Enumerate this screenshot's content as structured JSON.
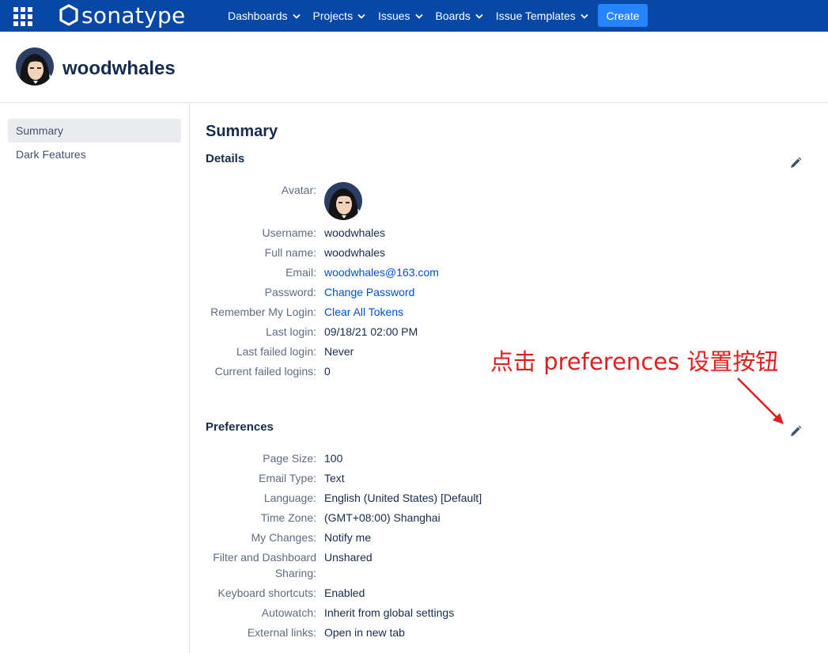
{
  "brand": {
    "name": "sonatype"
  },
  "topnav": {
    "items": [
      {
        "label": "Dashboards"
      },
      {
        "label": "Projects"
      },
      {
        "label": "Issues"
      },
      {
        "label": "Boards"
      },
      {
        "label": "Issue Templates"
      }
    ],
    "create_label": "Create"
  },
  "profile": {
    "name": "woodwhales"
  },
  "sidebar": {
    "items": [
      {
        "label": "Summary",
        "active": true
      },
      {
        "label": "Dark Features",
        "active": false
      }
    ]
  },
  "summary": {
    "title": "Summary",
    "details": {
      "heading": "Details",
      "avatar_label": "Avatar:",
      "rows": [
        {
          "label": "Username:",
          "value": "woodwhales"
        },
        {
          "label": "Full name:",
          "value": "woodwhales"
        },
        {
          "label": "Email:",
          "value": "woodwhales@163.com"
        },
        {
          "label": "Password:",
          "value": "Change Password"
        },
        {
          "label": "Remember My Login:",
          "value": "Clear All Tokens"
        },
        {
          "label": "Last login:",
          "value": "09/18/21 02:00 PM"
        },
        {
          "label": "Last failed login:",
          "value": "Never"
        },
        {
          "label": "Current failed logins:",
          "value": "0"
        }
      ]
    },
    "preferences": {
      "heading": "Preferences",
      "rows": [
        {
          "label": "Page Size:",
          "value": "100"
        },
        {
          "label": "Email Type:",
          "value": "Text"
        },
        {
          "label": "Language:",
          "value": "English (United States) [Default]"
        },
        {
          "label": "Time Zone:",
          "value": "(GMT+08:00) Shanghai"
        },
        {
          "label": "My Changes:",
          "value": "Notify me"
        },
        {
          "label": "Filter and Dashboard",
          "label2": "Sharing:",
          "value": "Unshared"
        },
        {
          "label": "Keyboard shortcuts:",
          "value": "Enabled"
        },
        {
          "label": "Autowatch:",
          "value": "Inherit from global settings"
        },
        {
          "label": "External links:",
          "value": "Open in new tab"
        }
      ]
    }
  },
  "annotation": {
    "text": "点击 preferences 设置按钮"
  },
  "icons": {
    "app_switcher": "grid-icon",
    "edit": "pencil-icon",
    "chevron": "chevron-down-icon",
    "arrow": "arrow-icon"
  },
  "colors": {
    "topbar": "#0747a6",
    "create_button": "#2684ff",
    "link": "#0052cc",
    "annotation": "#e02020"
  }
}
